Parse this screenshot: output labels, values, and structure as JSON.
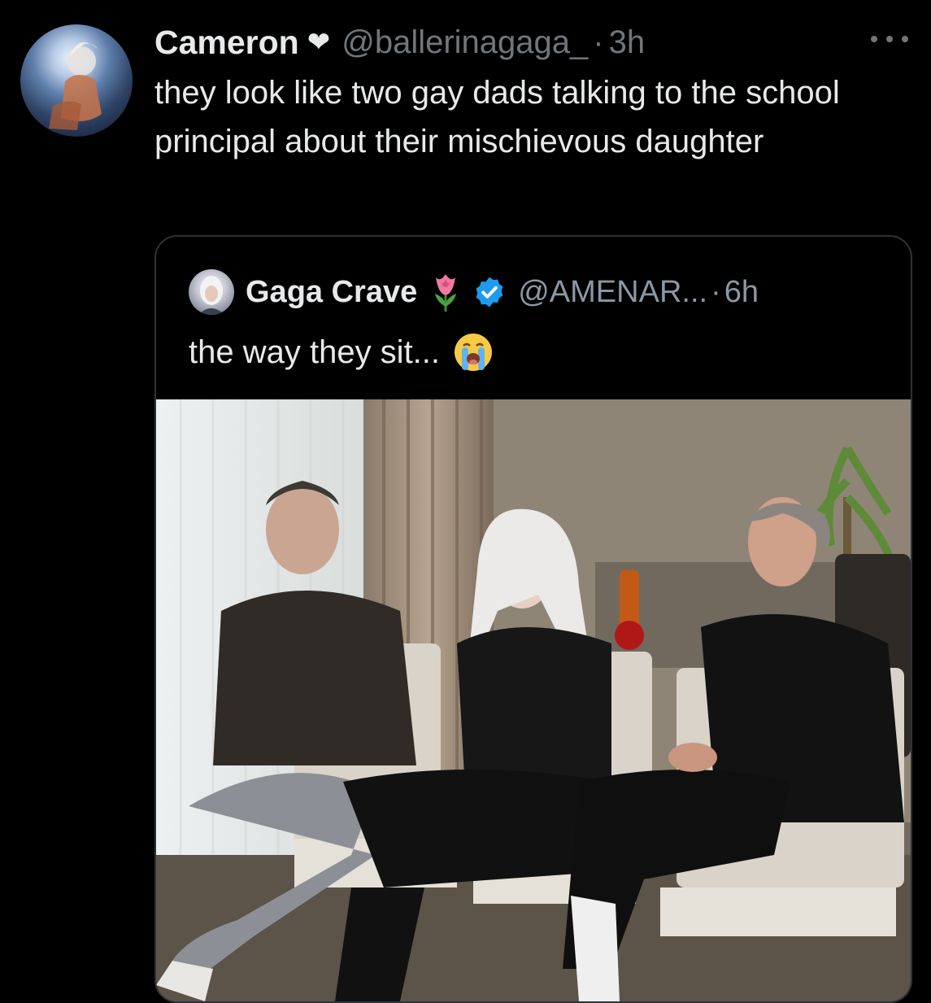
{
  "tweet": {
    "author_name": "Cameron",
    "author_handle": "@ballerinagaga_",
    "separator": "·",
    "time": "3h",
    "text": "they look like two gay dads talking to the school principal about their mischievous daughter"
  },
  "quoted_tweet": {
    "author_name": "Gaga Crave",
    "author_handle": "@AMENAR...",
    "separator": "·",
    "time": "6h",
    "text": "the way they sit..."
  },
  "colors": {
    "background": "#000000",
    "primary_text": "#e7e9ea",
    "secondary_text": "#71767b",
    "border": "#2f3336",
    "verified_blue": "#1d9bf0"
  },
  "icons": [
    "heart-icon",
    "more-icon",
    "tulip-icon",
    "verified-icon",
    "crying-face-icon"
  ]
}
